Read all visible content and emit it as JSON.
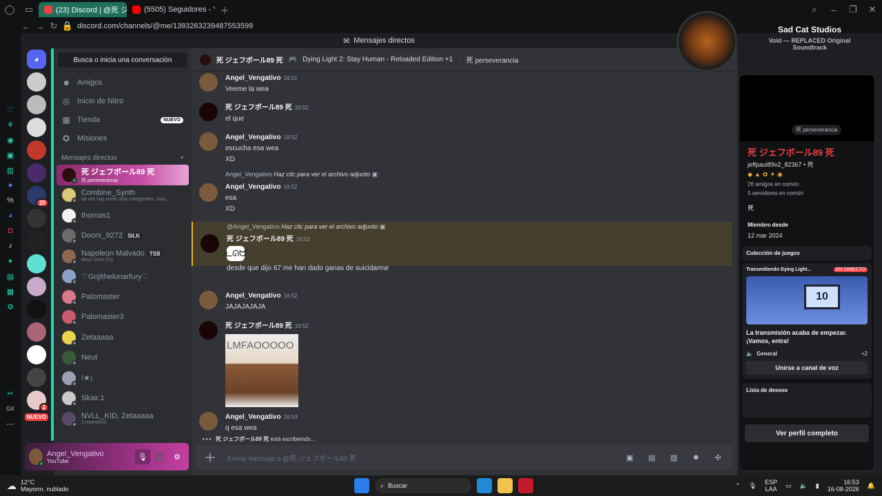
{
  "browser": {
    "tabs": [
      {
        "label": "(23) Discord | @死 ジェフボー",
        "active": true
      },
      {
        "label": "(5505) Seguidores - YouTu",
        "active": false
      }
    ],
    "url": "discord.com/channels/@me/1393263239487553599"
  },
  "discord": {
    "top_title": "Mensajes directos",
    "search_placeholder": "Busca o inicia una conversación",
    "nav": [
      {
        "label": "Amigos",
        "icon": "friends-icon"
      },
      {
        "label": "Inicio de Nitro",
        "icon": "nitro-icon"
      },
      {
        "label": "Tienda",
        "icon": "shop-icon",
        "badge": "NUEVO"
      },
      {
        "label": "Misiones",
        "icon": "quests-icon"
      }
    ],
    "dm_header": "Mensajes directos",
    "dm_add": "+",
    "dms": [
      {
        "name": "死 ジェフボール89 死",
        "sub": "死 perseverancia",
        "active": true,
        "color": "#2b0d0d",
        "online": true
      },
      {
        "name": "Combine_Synth",
        "sub": "tal vez hay seres más inteligentes, más...",
        "color": "#d8c87a",
        "online": false
      },
      {
        "name": "thomas1",
        "sub": "",
        "color": "#f2f2f2",
        "online": false
      },
      {
        "name": "Doors_9272",
        "sub": "",
        "tag": "SILK",
        "color": "#6b6b6b",
        "online": false
      },
      {
        "name": "Napoleon Malvado",
        "sub": "Boys Don't Cry",
        "tag": "TSB",
        "color": "#8b6a4f",
        "online": false
      },
      {
        "name": "♡Gojithelunarfury♡",
        "sub": "",
        "color": "#8da0c9",
        "online": false
      },
      {
        "name": "Palomaster",
        "sub": "",
        "color": "#d67a8b",
        "online": false
      },
      {
        "name": "Palomaster3",
        "sub": "",
        "color": "#c95a70",
        "online": false
      },
      {
        "name": "Zetaaaaa",
        "sub": "",
        "color": "#e8d44d",
        "online": false
      },
      {
        "name": "Neut",
        "sub": "",
        "color": "#3a5a3a",
        "online": false
      },
      {
        "name": "!★¡",
        "sub": "",
        "color": "#9aa0b0",
        "online": false
      },
      {
        "name": "Skair.1",
        "sub": "",
        "color": "#c9c9c9",
        "online": false
      },
      {
        "name": "NVLL_KID, Zetaaaaa",
        "sub": "3 miembros",
        "color": "#5a4a6a",
        "online": false
      }
    ],
    "user": {
      "name": "Angel_Vengativo",
      "status": "YouTube"
    },
    "chat_header": {
      "name": "死 ジェフボール89 死",
      "activity": "Dying Light 2: Stay Human - Reloaded Edition +1",
      "status": "死 perseverancia"
    },
    "messages": [
      {
        "author": "Angel_Vengativo",
        "time": "16:51",
        "lines": [
          "Veeme la wea"
        ]
      },
      {
        "author": "死 ジェフボール89 死",
        "time": "16:52",
        "lines": [
          "el que"
        ]
      },
      {
        "author": "Angel_Vengativo",
        "time": "16:52",
        "lines": [
          "escucha esa wea",
          "XD"
        ]
      },
      {
        "reply_to": "Angel_Vengativo",
        "reply_text": "Haz clic para ver el archivo adjunto",
        "author": "Angel_Vengativo",
        "time": "16:52",
        "lines": [
          "esa",
          "XD"
        ]
      },
      {
        "reply_to": "@Angel_Vengativo",
        "reply_text": "Haz clic para ver el archivo adjunto",
        "author": "死 ジェフボール89 死",
        "time": "16:52",
        "lines": [
          "desde que dijo 67 me han dado ganas de suicidarme"
        ],
        "highlight": true
      },
      {
        "author": "Angel_Vengativo",
        "time": "16:52",
        "lines": [
          "JAJAJAJAJA"
        ]
      },
      {
        "author": "死 ジェフボール89 死",
        "time": "16:52",
        "image_text": "LMFAOOOOO"
      },
      {
        "author": "Angel_Vengativo",
        "time": "16:53",
        "lines": [
          "q esa wea"
        ]
      }
    ],
    "typing": {
      "name": "死 ジェフボール89 死",
      "text": "está escribiendo..."
    },
    "composer_placeholder": "Enviar mensaje a @死 ジェフボール89 死"
  },
  "now_playing": {
    "artist": "Sad Cat Studios",
    "track": "Void — REPLACED Original Soundtrack"
  },
  "profile": {
    "name": "死 ジェフボール89 死",
    "username": "jeffpaul89v2_82367",
    "username_suffix": "• 死",
    "status": "死 perseverancia",
    "mutual_friends": "26 amigos en común",
    "mutual_servers": "5 servidores en común",
    "bio": "死",
    "member_since_label": "Miembro desde",
    "member_since": "12 mar 2024",
    "games_label": "Colección de juegos",
    "streaming_label": "Transmitiendo Dying Light...",
    "live_badge": "EN DIRECTO",
    "stream_text": "La transmisión acaba de empezar. ¡Vamos, entra!",
    "voice_channel": "General",
    "voice_count": "+2",
    "join_voice": "Unirse a canal de voz",
    "wishlist_label": "Lista de deseos",
    "view_profile": "Ver perfil completo"
  },
  "taskbar": {
    "weather_temp": "12°C",
    "weather_desc": "Mayorm. nublado",
    "search": "Buscar",
    "lang": "ESP",
    "layout": "LAA",
    "time": "16:53",
    "date": "16-08-2026"
  },
  "colors": {
    "accent": "#20d6b3",
    "discord_blurple": "#5865f2",
    "nitro_pink": "#c84fa7"
  }
}
